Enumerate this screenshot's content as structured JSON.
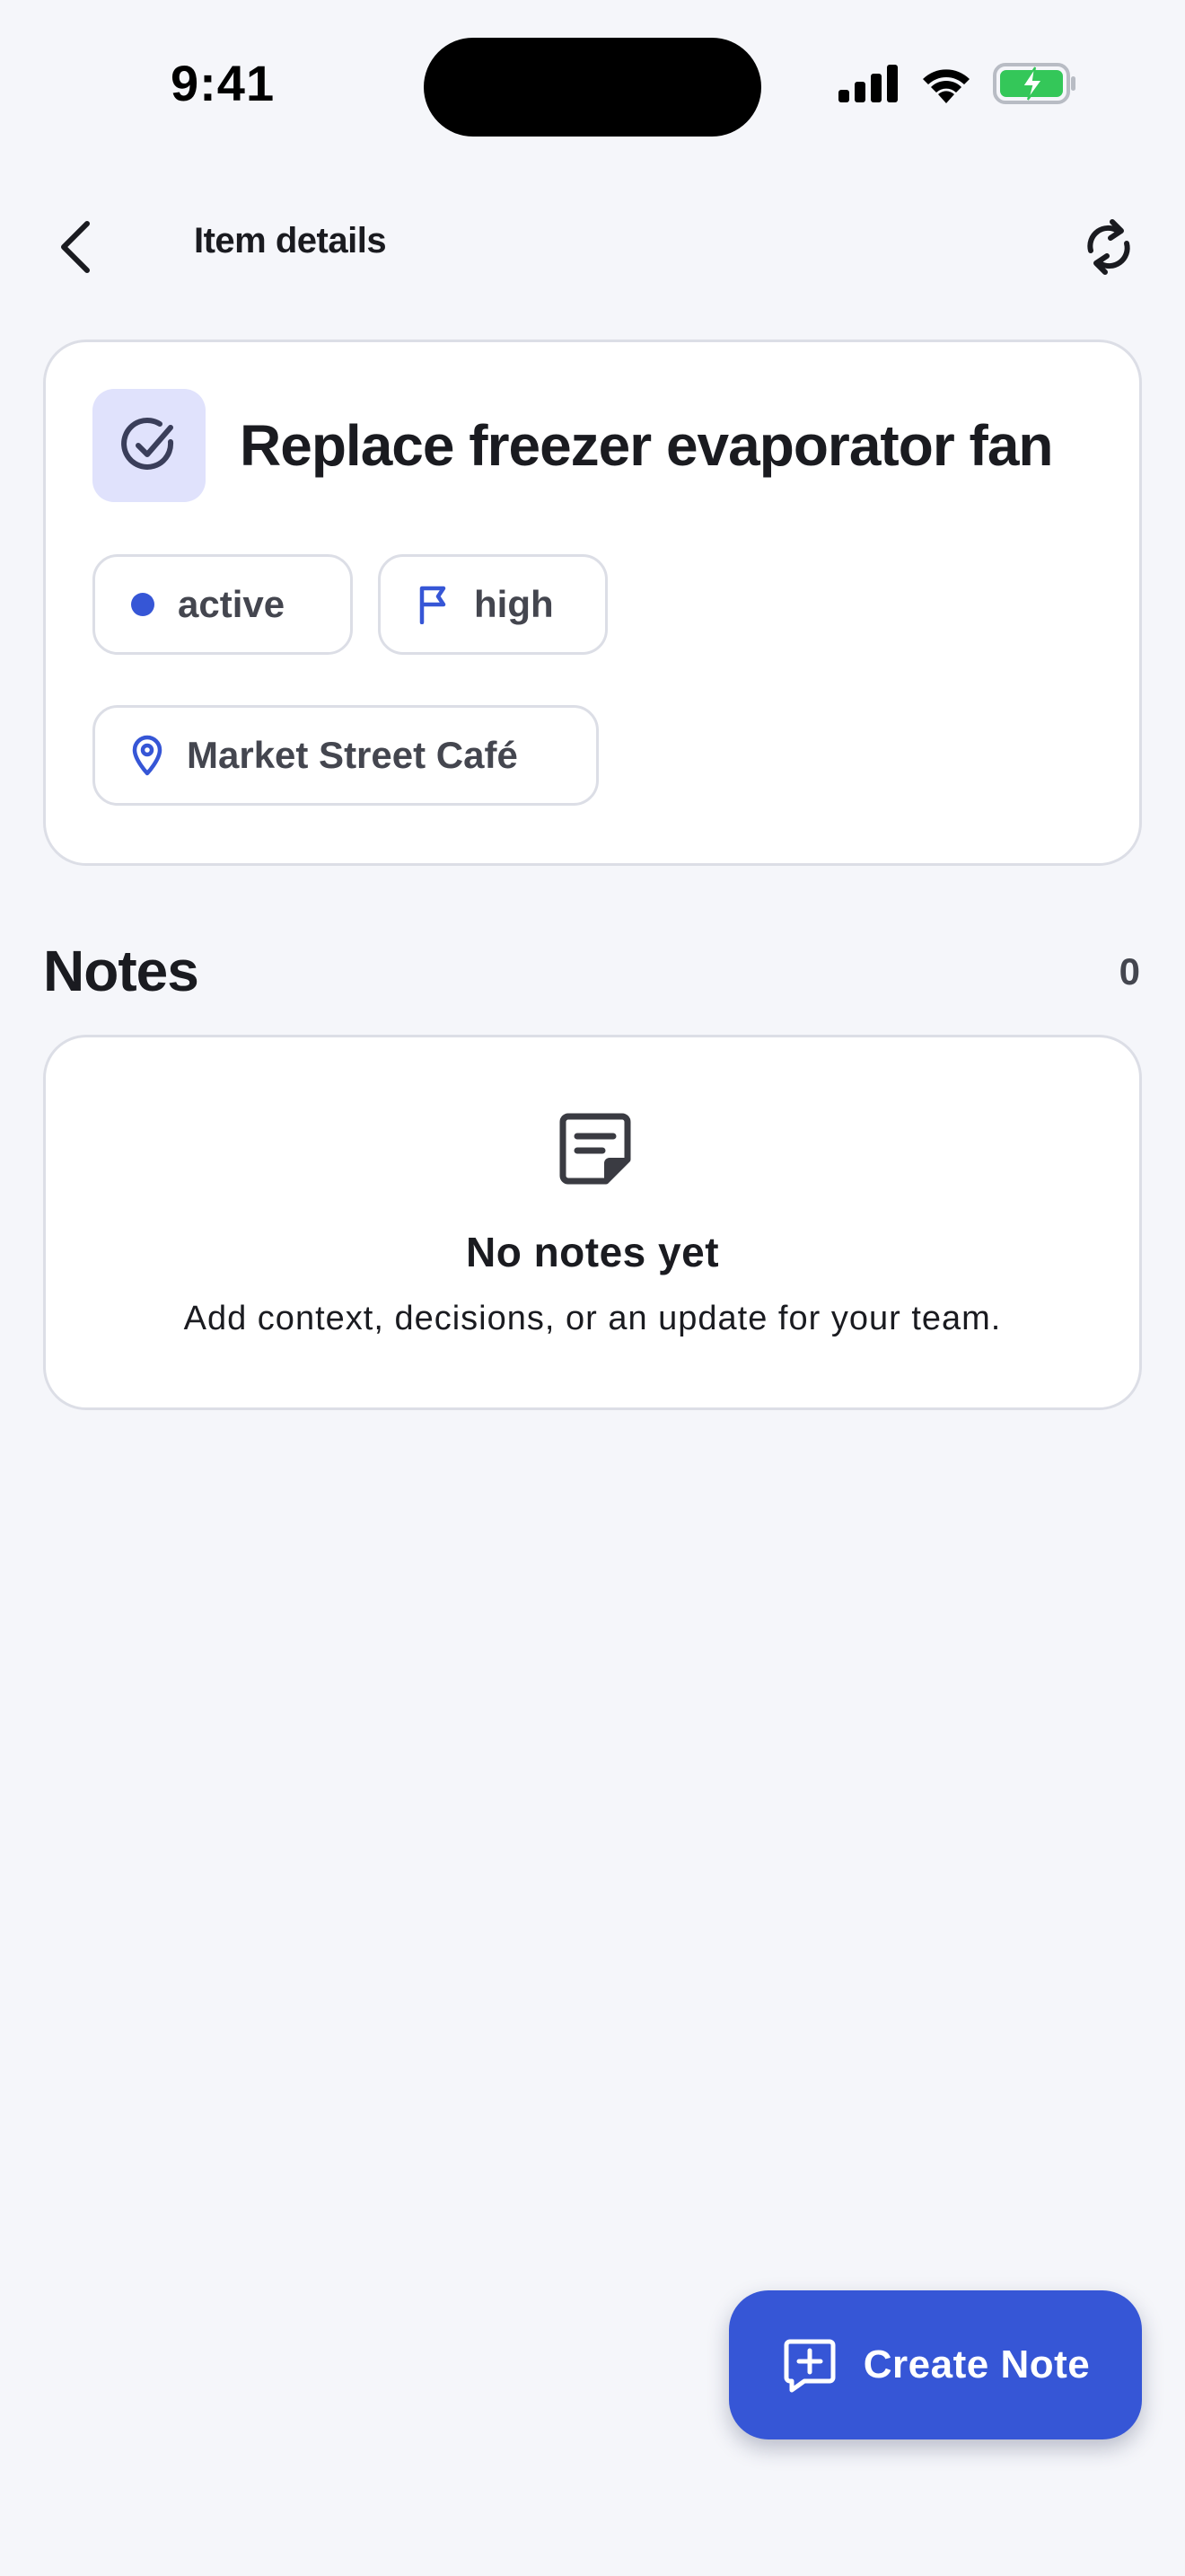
{
  "status_bar": {
    "time": "9:41"
  },
  "nav": {
    "title": "Item details",
    "back_icon": "chevron-left-icon",
    "refresh_icon": "refresh-icon"
  },
  "item": {
    "title": "Replace freezer evaporator fan",
    "status": "active",
    "priority": "high",
    "location": "Market Street Café"
  },
  "notes": {
    "title": "Notes",
    "count": "0",
    "empty_title": "No notes yet",
    "empty_subtitle": "Add context, decisions, or an update for your team."
  },
  "fab": {
    "label": "Create Note"
  },
  "colors": {
    "accent": "#3656D6",
    "background": "#F5F6FA",
    "icon_tile": "#E0E2FC",
    "battery": "#34C759"
  }
}
